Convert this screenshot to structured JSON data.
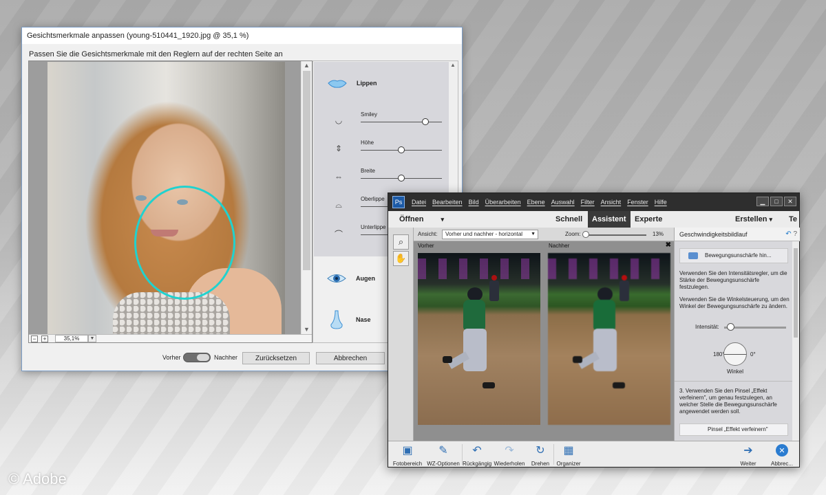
{
  "watermark": {
    "copyright": "© Adobe"
  },
  "face_dialog": {
    "title": "Gesichtsmerkmale anpassen (young-510441_1920.jpg @ 35,1 %)",
    "instruction": "Passen Sie die Gesichtsmerkmale mit den Reglern auf der rechten Seite an",
    "zoom_value": "35,1%",
    "zoom_minus": "−",
    "zoom_plus": "+",
    "lips_header": "Lippen",
    "sliders": [
      {
        "label": "Smiley",
        "icon": "smile-icon",
        "value": 0.8
      },
      {
        "label": "Höhe",
        "icon": "height-icon",
        "value": 0.5
      },
      {
        "label": "Breite",
        "icon": "width-icon",
        "value": 0.5
      },
      {
        "label": "Oberlippe",
        "icon": "upper-lip-icon",
        "value": 0.5
      },
      {
        "label": "Unterlippe",
        "icon": "lower-lip-icon",
        "value": 0.5
      }
    ],
    "eyes_header": "Augen",
    "nose_header": "Nase",
    "toggle_before": "Vorher",
    "toggle_after": "Nachher",
    "reset_button": "Zurücksetzen",
    "cancel_button": "Abbrechen",
    "accent_color": "#20d2cf"
  },
  "editor": {
    "logo_text": "Ps",
    "menu": [
      "Datei",
      "Bearbeiten",
      "Bild",
      "Überarbeiten",
      "Ebene",
      "Auswahl",
      "Filter",
      "Ansicht",
      "Fenster",
      "Hilfe"
    ],
    "open_label": "Öffnen",
    "open_dropdown": "▾",
    "modes": [
      "Schnell",
      "Assistent",
      "Experte"
    ],
    "active_mode": "Assistent",
    "create_label": "Erstellen",
    "create_dropdown": "▾",
    "truncated_tab": "Te",
    "view_label": "Ansicht:",
    "view_value": "Vorher und nachher - horizontal",
    "zoom_label": "Zoom:",
    "zoom_value": "13%",
    "before_label": "Vorher",
    "after_label": "Nachher",
    "close_glyph": "✖",
    "panel_title": "Geschwindigkeitsbildlauf",
    "effect_button": "Bewegungsunschärfe hin...",
    "text_intensity": "Verwenden Sie den Intensitätsregler, um die Stärke der Bewegungsunschärfe festzulegen.",
    "text_angle": "Verwenden Sie die Winkelsteuerung, um den Winkel der Bewegungsunschärfe zu ändern.",
    "intensity_label": "Intensität:",
    "intensity_value": 0.1,
    "angle_left": "180°",
    "angle_right": "0°",
    "angle_label": "Winkel",
    "step3_text": "3. Verwenden Sie den Pinsel „Effekt verfeinern\", um genau festzulegen, an welcher Stelle die Bewegungsunschärfe angewendet werden soll.",
    "refine_button": "Pinsel „Effekt verfeinern\"",
    "bottom_items": [
      {
        "label": "Fotobereich",
        "icon": "photo-bin-icon"
      },
      {
        "label": "WZ-Optionen",
        "icon": "tool-options-icon"
      },
      {
        "label": "Rückgängig",
        "icon": "undo-icon"
      },
      {
        "label": "Wiederholen",
        "icon": "redo-icon"
      },
      {
        "label": "Drehen",
        "icon": "rotate-icon"
      },
      {
        "label": "Organizer",
        "icon": "organizer-icon"
      },
      {
        "label": "Weiter",
        "icon": "next-icon"
      },
      {
        "label": "Abbrec...",
        "icon": "cancel-icon"
      }
    ]
  }
}
